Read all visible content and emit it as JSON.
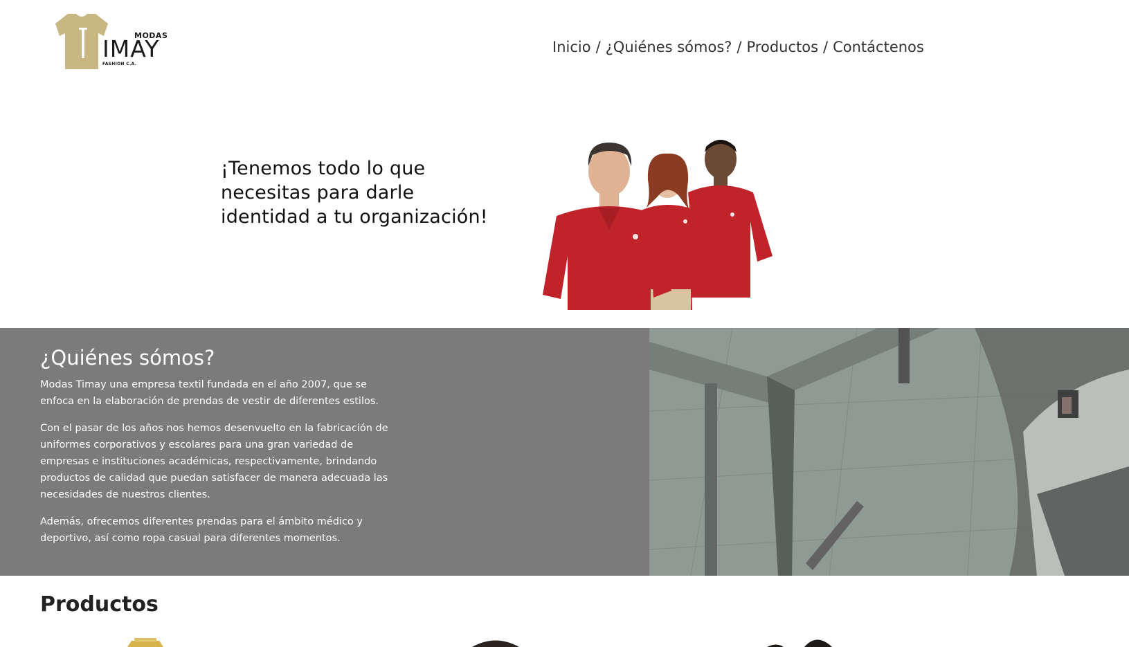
{
  "brand": {
    "modas": "MODAS",
    "name": "IMAY",
    "initial": "T",
    "subtitle": "FASHION C.A.",
    "logo_color": "#C8B683"
  },
  "nav": {
    "items": [
      {
        "label": "Inicio"
      },
      {
        "label": "¿Quiénes sómos?"
      },
      {
        "label": "Productos"
      },
      {
        "label": "Contáctenos"
      }
    ],
    "separator": "/"
  },
  "hero": {
    "line1": "¡Tenemos todo lo que",
    "line2": "necesitas para darle",
    "line3": "identidad a tu organización!"
  },
  "about": {
    "title": "¿Quiénes sómos?",
    "paragraphs": [
      "Modas Timay una empresa textil fundada en el año 2007, que se enfoca en la elaboración de prendas de vestir de diferentes estilos.",
      "Con el pasar de los años nos hemos desenvuelto en la fabricación de uniformes corporativos y escolares para una gran variedad de empresas e instituciones académicas, respectivamente, brindando productos de calidad que puedan satisfacer de manera adecuada las necesidades de nuestros clientes.",
      "Además, ofrecemos diferentes prendas para el ámbito médico y deportivo, así como ropa casual para diferentes momentos."
    ],
    "background": "#7B7B7B"
  },
  "products": {
    "title": "Productos"
  },
  "colors": {
    "polo_red": "#C0232A",
    "gold": "#C8B683"
  }
}
